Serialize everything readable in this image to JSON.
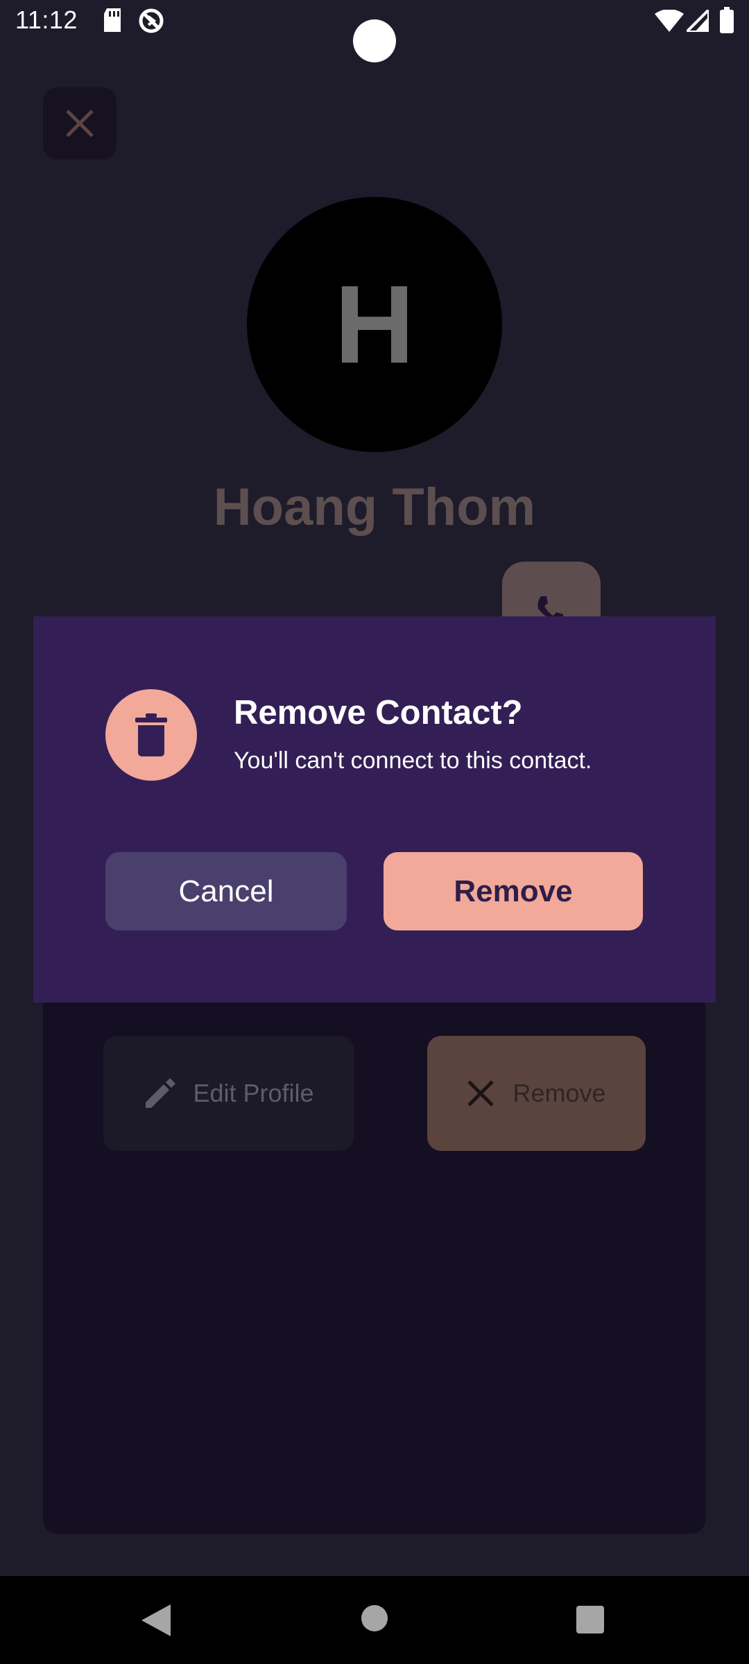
{
  "status_bar": {
    "time": "11:12",
    "icons": [
      "sd-card-icon",
      "no-data-icon",
      "wifi-icon",
      "signal-icon",
      "battery-icon"
    ]
  },
  "background": {
    "close_icon": "close-icon",
    "avatar_initial": "H",
    "contact_name": "Hoang Thom",
    "call_icon": "phone-icon",
    "edit_profile_label": "Edit Profile",
    "remove_label": "Remove"
  },
  "dialog": {
    "icon": "trash-icon",
    "title": "Remove Contact?",
    "message": "You'll can't connect to this contact.",
    "cancel_label": "Cancel",
    "remove_label": "Remove"
  },
  "nav_bar": {
    "icons": [
      "back-icon",
      "home-icon",
      "recents-icon"
    ]
  },
  "colors": {
    "background": "#1e1b2b",
    "dialog": "#331f55",
    "accent": "#f2a99a",
    "cancel": "#4a406d"
  }
}
